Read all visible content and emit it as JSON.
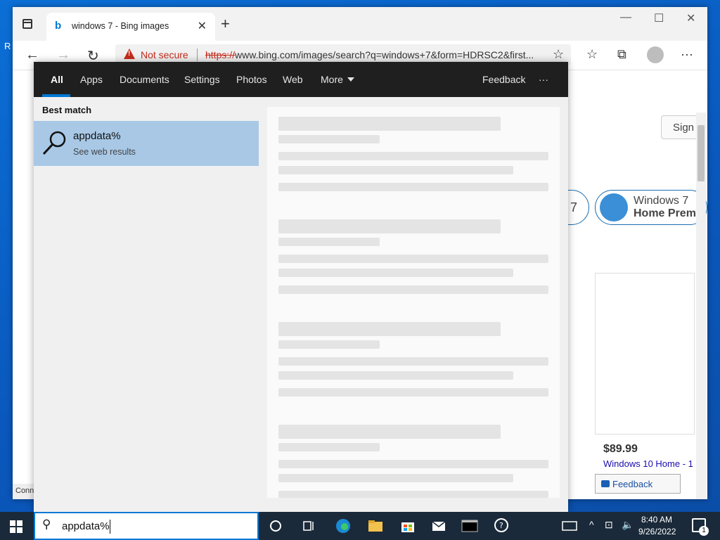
{
  "browser": {
    "tab_title": "windows 7 - Bing images",
    "security_label": "Not secure",
    "url_scheme": "https://",
    "url_rest": "www.bing.com/images/search?q=windows+7&form=HDRSC2&first..."
  },
  "page": {
    "sign_in_label": "Sign",
    "chip_left_text": "7",
    "chip_title": "Windows 7",
    "chip_subtitle": "Home Premi",
    "price": "$89.99",
    "product_title": "Windows 10 Home - 1",
    "feedback_label": "Feedback",
    "status_fragment": "Conn"
  },
  "search_flyout": {
    "tabs": [
      "All",
      "Apps",
      "Documents",
      "Settings",
      "Photos",
      "Web",
      "More"
    ],
    "feedback_label": "Feedback",
    "more_options": "···",
    "best_match_label": "Best match",
    "result_title": "appdata%",
    "result_subtitle": "See web results"
  },
  "taskbar": {
    "search_value": "appdata%",
    "time": "8:40 AM",
    "date": "9/26/2022",
    "notification_count": "1"
  },
  "colors": {
    "accent": "#0078d4",
    "flyout_tabs_bg": "#1f1f1f",
    "result_highlight": "#a8c8e6",
    "insecure_red": "#c42b1c"
  }
}
